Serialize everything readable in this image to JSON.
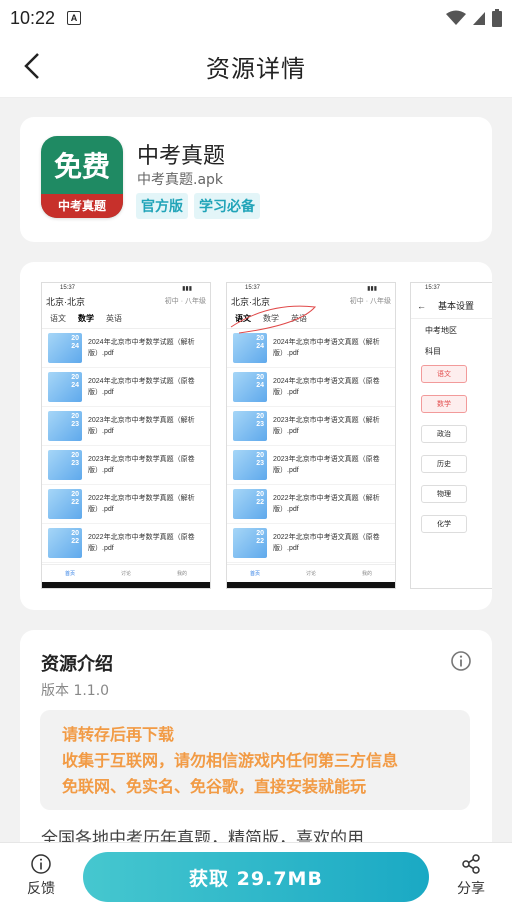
{
  "status": {
    "time": "10:22",
    "notif": "A"
  },
  "appbar": {
    "title": "资源详情"
  },
  "app": {
    "name": "中考真题",
    "file": "中考真题.apk",
    "icon_text": "免费",
    "icon_band": "中考真题",
    "tags": [
      "官方版",
      "学习必备"
    ]
  },
  "screens": {
    "s1": {
      "time": "15:37",
      "loc": "北京·北京",
      "grade": "初中 · 八年级",
      "tabs": [
        "语文",
        "数学",
        "英语"
      ],
      "items": [
        {
          "year": "20\n24",
          "text": "2024年北京市中考数学试题（解析版）.pdf"
        },
        {
          "year": "20\n24",
          "text": "2024年北京市中考数学试题（原卷版）.pdf"
        },
        {
          "year": "20\n23",
          "text": "2023年北京市中考数学真题（解析版）.pdf"
        },
        {
          "year": "20\n23",
          "text": "2023年北京市中考数学真题（原卷版）.pdf"
        },
        {
          "year": "20\n22",
          "text": "2022年北京市中考数学真题（解析版）.pdf"
        },
        {
          "year": "20\n22",
          "text": "2022年北京市中考数学真题（原卷版）.pdf"
        }
      ],
      "nav": [
        "首页",
        "讨论",
        "我的"
      ]
    },
    "s2": {
      "time": "15:37",
      "loc": "北京·北京",
      "grade": "初中 · 八年级",
      "tabs": [
        "语文",
        "数学",
        "英语"
      ],
      "items": [
        {
          "text": "2024年北京市中考语文真题（解析版）.pdf"
        },
        {
          "text": "2024年北京市中考语文真题（原卷版）.pdf"
        },
        {
          "text": "2023年北京市中考语文真题（解析版）.pdf"
        },
        {
          "text": "2023年北京市中考语文真题（原卷版）.pdf"
        },
        {
          "text": "2022年北京市中考语文真题（解析版）.pdf"
        },
        {
          "text": "2022年北京市中考语文真题（原卷版）.pdf"
        }
      ],
      "nav": [
        "首页",
        "讨论",
        "我的"
      ]
    },
    "s3": {
      "time": "15:37",
      "title": "基本设置",
      "label1": "中考地区",
      "label2": "科目",
      "pills": [
        "语文",
        "数学",
        "政治",
        "历史",
        "物理",
        "化学"
      ]
    }
  },
  "intro": {
    "title": "资源介绍",
    "version": "版本 1.1.0",
    "notice": [
      "请转存后再下载",
      "收集于互联网，请勿相信游戏内任何第三方信息",
      "免联网、免实名、免谷歌，直接安装就能玩"
    ],
    "desc": "全国各地中考历年真题，精简版，喜欢的用"
  },
  "bottom": {
    "feedback": "反馈",
    "get": "获取 29.7MB",
    "share": "分享"
  },
  "colors": {
    "accent": "#1aa9c4",
    "notice": "#f29b45",
    "tag": "#21a4b8"
  }
}
